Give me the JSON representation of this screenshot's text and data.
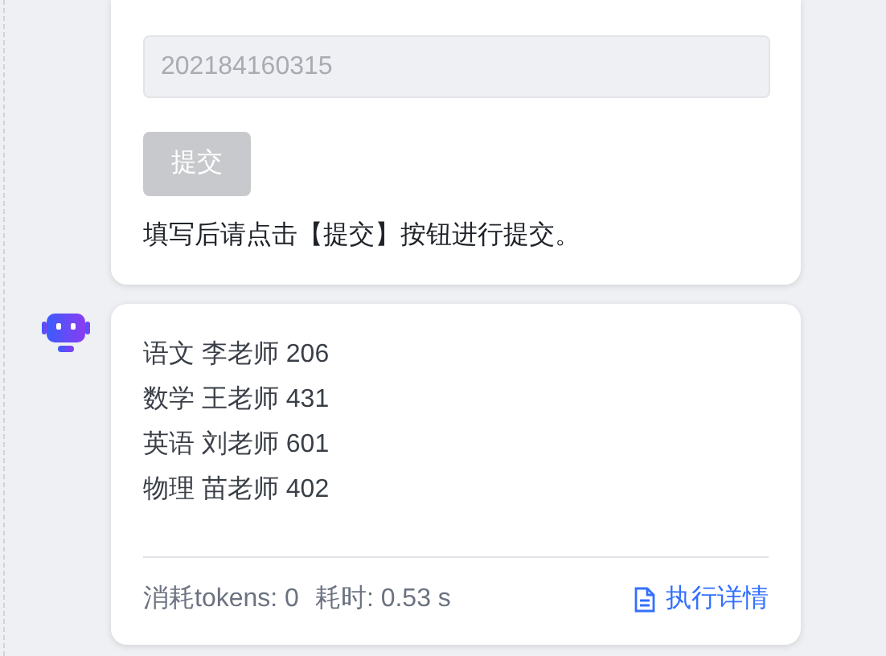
{
  "form_card": {
    "field": {
      "value": "202184160315",
      "disabled": true
    },
    "submit_button": {
      "label": "提交",
      "disabled": true
    },
    "hint": "填写后请点击【提交】按钮进行提交。"
  },
  "reply_card": {
    "lines": [
      "语文 李老师 206",
      "数学 王老师 431",
      "英语 刘老师 601",
      "物理 苗老师 402"
    ],
    "footer": {
      "tokens": "消耗tokens: 0",
      "time": "耗时: 0.53 s",
      "details_link": "执行详情"
    }
  }
}
